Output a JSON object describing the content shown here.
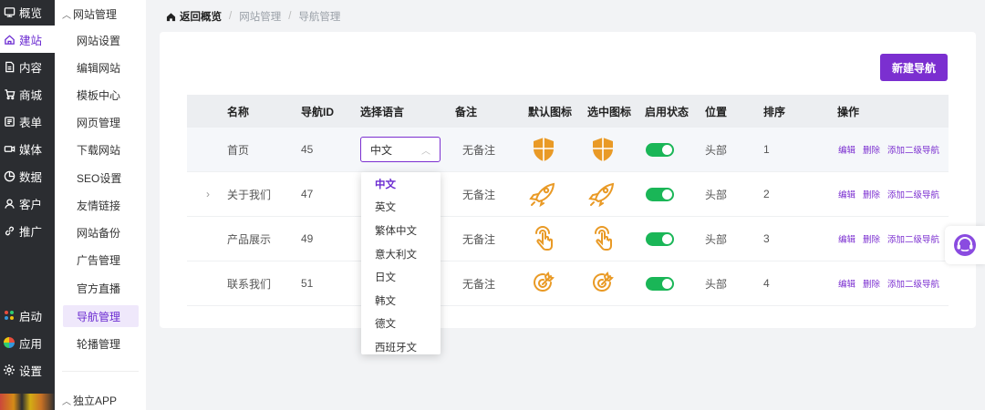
{
  "rail": {
    "items": [
      {
        "label": "概览",
        "icon": "overview-icon"
      },
      {
        "label": "建站",
        "icon": "home-icon"
      },
      {
        "label": "内容",
        "icon": "document-icon"
      },
      {
        "label": "商城",
        "icon": "cart-icon"
      },
      {
        "label": "表单",
        "icon": "form-icon"
      },
      {
        "label": "媒体",
        "icon": "video-icon"
      },
      {
        "label": "数据",
        "icon": "pie-chart-icon"
      },
      {
        "label": "客户",
        "icon": "user-icon"
      },
      {
        "label": "推广",
        "icon": "link-icon"
      }
    ],
    "bottom": [
      {
        "label": "启动",
        "icon": "launch-icon"
      },
      {
        "label": "应用",
        "icon": "apps-icon"
      },
      {
        "label": "设置",
        "icon": "gear-icon"
      }
    ]
  },
  "submenu": {
    "group_title": "网站管理",
    "items": [
      "网站设置",
      "编辑网站",
      "模板中心",
      "网页管理",
      "下载网站",
      "SEO设置",
      "友情链接",
      "网站备份",
      "广告管理",
      "官方直播",
      "导航管理",
      "轮播管理"
    ],
    "active_index": 10,
    "group2_title": "独立APP"
  },
  "breadcrumb": {
    "home": "返回概览",
    "level1": "网站管理",
    "level2": "导航管理"
  },
  "actions": {
    "new_nav": "新建导航"
  },
  "table": {
    "headers": [
      "名称",
      "导航ID",
      "选择语言",
      "备注",
      "默认图标",
      "选中图标",
      "启用状态",
      "位置",
      "排序",
      "操作"
    ],
    "rows": [
      {
        "name": "首页",
        "id": "45",
        "lang": "中文",
        "note": "无备注",
        "icon": "shield-icon",
        "position": "头部",
        "order": "1",
        "enabled": true
      },
      {
        "name": "关于我们",
        "id": "47",
        "lang": "",
        "note": "无备注",
        "icon": "rocket-icon",
        "position": "头部",
        "order": "2",
        "enabled": true
      },
      {
        "name": "产品展示",
        "id": "49",
        "lang": "",
        "note": "无备注",
        "icon": "touch-icon",
        "position": "头部",
        "order": "3",
        "enabled": true
      },
      {
        "name": "联系我们",
        "id": "51",
        "lang": "",
        "note": "无备注",
        "icon": "target-icon",
        "position": "头部",
        "order": "4",
        "enabled": true
      }
    ],
    "ops": [
      "编辑",
      "删除",
      "添加二级导航"
    ]
  },
  "language_dropdown": {
    "selected": "中文",
    "options": [
      "中文",
      "英文",
      "繁体中文",
      "意大利文",
      "日文",
      "韩文",
      "德文",
      "西班牙文"
    ]
  },
  "colors": {
    "accent": "#7b2fd0",
    "toggle_on": "#1ab657",
    "icon_orange": "#e99a26"
  }
}
